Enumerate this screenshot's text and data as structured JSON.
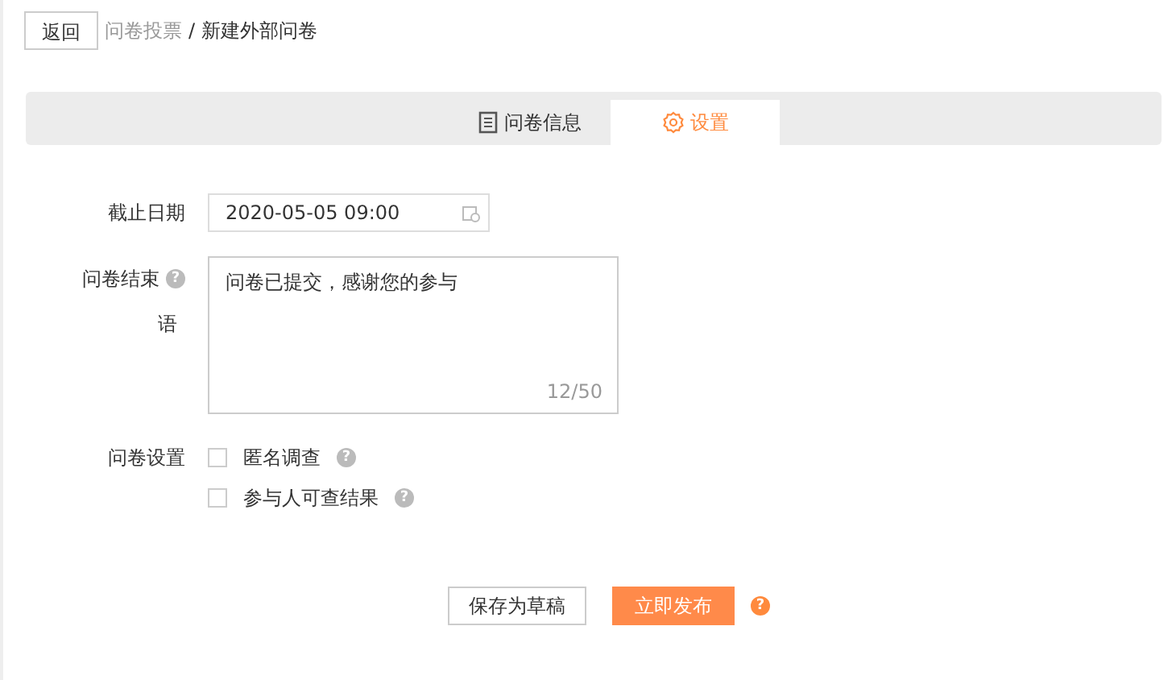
{
  "back_button": "返回",
  "breadcrumb": [
    {
      "label": "问卷投票",
      "current": false
    },
    {
      "label": "/ 新建外部问卷",
      "current": true
    }
  ],
  "tabs": [
    {
      "label": "问卷信息",
      "kind": "document",
      "selected": false
    },
    {
      "label": "设置",
      "kind": "gear",
      "selected": true
    }
  ],
  "deadline": {
    "label": "截止日期",
    "value": "2020-05-05 09:00"
  },
  "closing_message": {
    "label": "问卷结束",
    "label_line2": "语",
    "help": "?",
    "value": "问卷已提交，感谢您的参与",
    "counter": "12/50"
  },
  "settings": {
    "label": "问卷设置",
    "options": [
      {
        "label": "匿名调查",
        "checked": false,
        "help": "?"
      },
      {
        "label": "参与人可查结果",
        "checked": false,
        "help": "?"
      }
    ]
  },
  "buttons": [
    {
      "label": "保存为草稿",
      "kind": "secondary"
    },
    {
      "label": "立即发布",
      "kind": "primary",
      "help": "?"
    }
  ]
}
